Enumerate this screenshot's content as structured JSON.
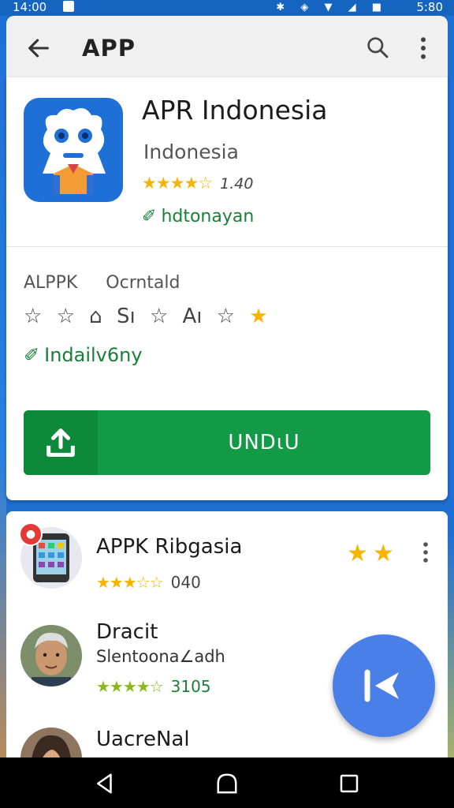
{
  "status_bar": {
    "time_left": "14:00",
    "time_right": "5:80"
  },
  "app_bar": {
    "title": "APP"
  },
  "app": {
    "name": "APR Indonesia",
    "subtitle": "Indonesia",
    "stars": "★★★★☆",
    "rating_count": "1.40",
    "developer": "hdtonayan"
  },
  "info": {
    "label_1": "ALPPK",
    "label_2": "Ocrntald",
    "rating_marks": [
      "☆",
      "☆",
      "⌂",
      "Sı",
      "☆",
      "Aı",
      "☆",
      "★"
    ],
    "verify_text": "Indailv6ny"
  },
  "install": {
    "label": "UNDιU"
  },
  "list": [
    {
      "name": "APPK Ribgasia",
      "sub": "",
      "stars": "★★★☆☆",
      "count": "040"
    },
    {
      "name": "Dracit",
      "sub": "Slentoona∠adh",
      "stars": "★★★★☆",
      "count": "3105"
    },
    {
      "name": "UacrеNal",
      "sub": "",
      "stars": "",
      "count": ""
    }
  ],
  "colors": {
    "accent_green": "#129a46",
    "brand_blue": "#1e6fd6",
    "fab_blue": "#4a7fe8",
    "star_gold": "#f4b400"
  }
}
